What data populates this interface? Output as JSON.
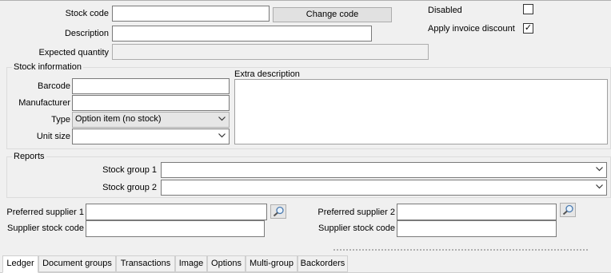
{
  "general": {
    "stock_code_label": "Stock code",
    "stock_code_value": "",
    "change_code_label": "Change code",
    "description_label": "Description",
    "description_value": "",
    "expected_quantity_label": "Expected quantity",
    "expected_quantity_value": "",
    "disabled_label": "Disabled",
    "disabled_checked": false,
    "apply_invoice_discount_label": "Apply invoice discount",
    "apply_invoice_discount_checked": true
  },
  "stock_information": {
    "group_title": "Stock information",
    "barcode_label": "Barcode",
    "barcode_value": "",
    "manufacturer_label": "Manufacturer",
    "manufacturer_value": "",
    "type_label": "Type",
    "type_value": "Option item (no stock)",
    "unit_size_label": "Unit size",
    "unit_size_value": "",
    "extra_description_label": "Extra description",
    "extra_description_value": ""
  },
  "reports": {
    "group_title": "Reports",
    "stock_group_1_label": "Stock group 1",
    "stock_group_1_value": "",
    "stock_group_2_label": "Stock group 2",
    "stock_group_2_value": ""
  },
  "suppliers": {
    "preferred_supplier_1_label": "Preferred supplier 1",
    "preferred_supplier_1_value": "",
    "supplier_stock_code_1_label": "Supplier stock code",
    "supplier_stock_code_1_value": "",
    "preferred_supplier_2_label": "Preferred supplier 2",
    "preferred_supplier_2_value": "",
    "supplier_stock_code_2_label": "Supplier stock code",
    "supplier_stock_code_2_value": ""
  },
  "tabs": [
    {
      "label": "Ledger",
      "active": true
    },
    {
      "label": "Document groups",
      "active": false
    },
    {
      "label": "Transactions",
      "active": false
    },
    {
      "label": "Image",
      "active": false
    },
    {
      "label": "Options",
      "active": false
    },
    {
      "label": "Multi-group",
      "active": false
    },
    {
      "label": "Backorders",
      "active": false
    }
  ],
  "icons": {
    "checkmark": "✓",
    "dropdown": "chevron-down-icon",
    "lookup": "magnifier-icon"
  }
}
